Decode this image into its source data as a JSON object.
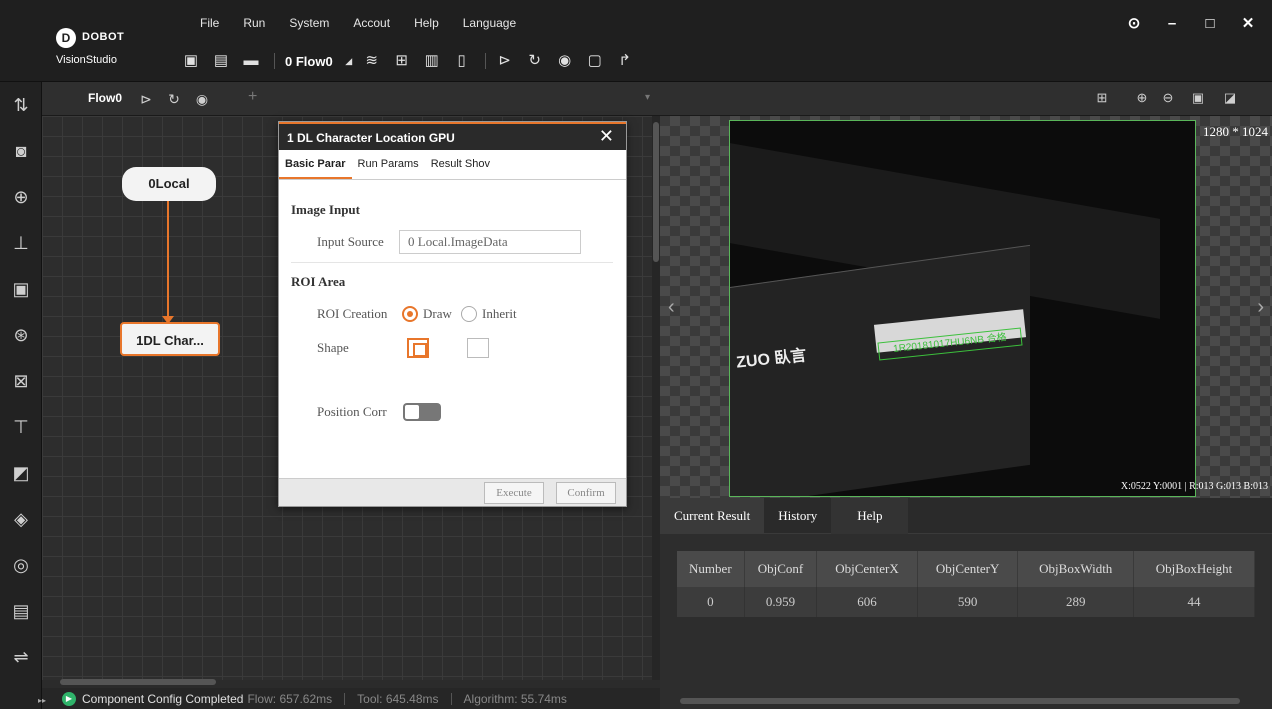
{
  "app": {
    "brand": "DOBOT",
    "product": "VisionStudio",
    "logo_glyph": "D"
  },
  "menu": [
    "File",
    "Run",
    "System",
    "Accout",
    "Help",
    "Language"
  ],
  "window_controls": {
    "history": "⊙",
    "minimize": "–",
    "maximize": "□",
    "close": "✕"
  },
  "toolbar": {
    "flow_selector": "0 Flow0"
  },
  "flow": {
    "tab_name": "Flow0",
    "nodes": [
      {
        "label": "0Local"
      },
      {
        "label": "1DL Char..."
      }
    ]
  },
  "status": {
    "message": "Component Config Completed",
    "flow_time": "Flow: 657.62ms",
    "tool_time": "Tool: 645.48ms",
    "algorithm_time": "Algorithm: 55.74ms"
  },
  "dialog": {
    "title": "1 DL Character Location GPU",
    "close": "✕",
    "tabs": [
      "Basic Parar",
      "Run Params",
      "Result Shov"
    ],
    "image_input": {
      "section": "Image Input",
      "source_label": "Input Source",
      "source_value": "0 Local.ImageData"
    },
    "roi": {
      "section": "ROI Area",
      "creation_label": "ROI Creation",
      "option_draw": "Draw",
      "option_inherit": "Inherit",
      "shape_label": "Shape",
      "position_label": "Position Corr"
    },
    "buttons": {
      "execute": "Execute",
      "confirm": "Confirm"
    }
  },
  "viewer": {
    "resolution": "1280 * 1024",
    "ocr_text": "1R20181017HU6NB 合格",
    "brand_text": "ZUO 臥言",
    "coords": "X:0522 Y:0001 | R:013 G:013 B:013"
  },
  "results": {
    "tabs": [
      "Current Result",
      "History",
      "Help"
    ],
    "columns": [
      "Number",
      "ObjConf",
      "ObjCenterX",
      "ObjCenterY",
      "ObjBoxWidth",
      "ObjBoxHeight"
    ],
    "rows": [
      [
        "0",
        "0.959",
        "606",
        "590",
        "289",
        "44"
      ]
    ]
  },
  "colors": {
    "accent": "#e8762b",
    "ok": "#2fb36a",
    "roi_box": "#3cc03c"
  }
}
